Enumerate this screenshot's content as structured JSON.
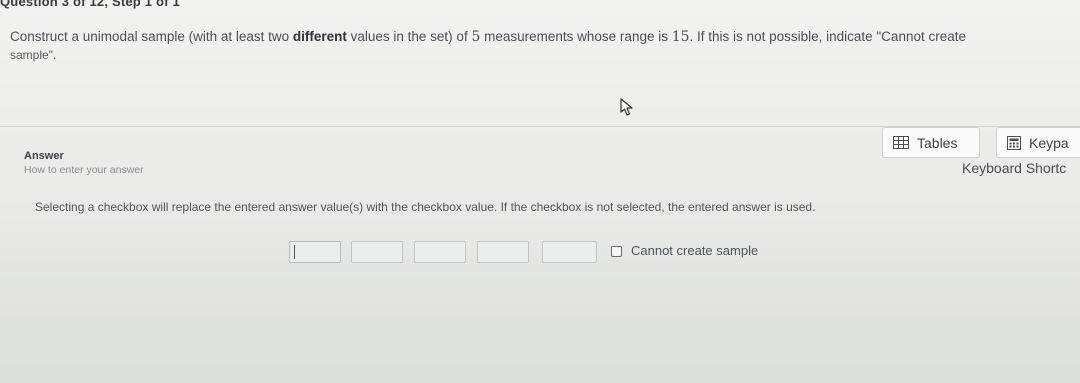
{
  "header": {
    "question_label": "Question 3 of 12, Step 1 of 1"
  },
  "prompt": {
    "part1": "Construct a unimodal sample (with at least two ",
    "bold": "different",
    "part2": " values in the set) of ",
    "n": "5",
    "part3": " measurements whose range is ",
    "range": "15",
    "part4": ".  If this is not possible, indicate \"Cannot create",
    "part5": "sample\"."
  },
  "answer": {
    "label": "Answer",
    "howto": "How to enter your answer",
    "notice": "Selecting a checkbox will replace the entered answer value(s) with the checkbox value. If the checkbox is not selected, the entered answer is used.",
    "inputs": [
      "",
      "",
      "",
      "",
      ""
    ],
    "checkbox_label": "Cannot create sample",
    "checkbox_checked": false
  },
  "tools": {
    "tables_label": "Tables",
    "keypad_label": "Keypa",
    "keyboard_shortcuts": "Keyboard Shortc"
  },
  "icons": {
    "tables": "table-grid-icon",
    "keypad": "keypad-icon",
    "cursor": "mouse-pointer-icon"
  }
}
